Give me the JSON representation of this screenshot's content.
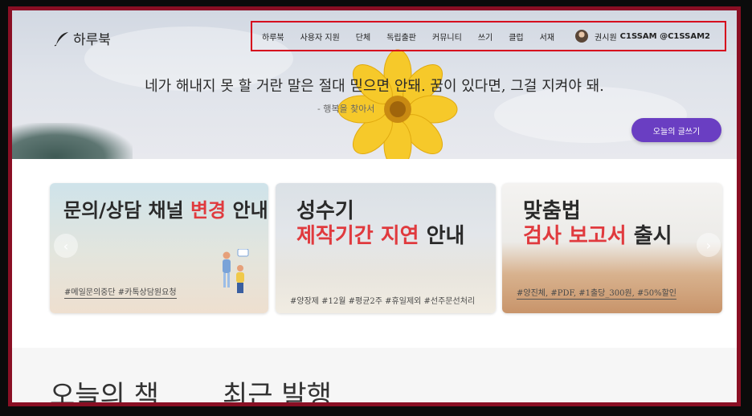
{
  "brand": {
    "logo_text": "하루북"
  },
  "nav": {
    "items": [
      "하루북",
      "사용자 지원",
      "단체",
      "독립출판",
      "커뮤니티",
      "쓰기",
      "클럽",
      "서재"
    ],
    "user_name": "권시원",
    "user_handle": "C1SSAM @C1SSAM2"
  },
  "hero": {
    "quote": "네가 해내지 못 할 거란 말은 절대 믿으면 안돼. 꿈이 있다면, 그걸 지켜야 돼.",
    "quote_source": "- 행복을 찾아서",
    "write_button": "오늘의 글쓰기"
  },
  "cards": [
    {
      "title_before": "문의/상담 채널 ",
      "title_highlight": "변경",
      "title_after": " 안내",
      "tags": "#메일문의중단 #카톡상담원요청"
    },
    {
      "line1": "성수기",
      "line2_highlight": "제작기간 지연",
      "line2_after": " 안내",
      "tags": "#양장제 #12월 #평균2주 #휴일제외 #선주문선처리"
    },
    {
      "line1": "맞춤법",
      "line2_highlight": "검사 보고서",
      "line2_after": " 출시",
      "tags": "#양진체, #PDF, #1출당_300원, #50%할인"
    }
  ],
  "sections": {
    "today_book": "오늘의 책",
    "recent": "최근 발행"
  },
  "icons": {
    "prev": "chevron-left-icon",
    "next": "chevron-right-icon",
    "logo": "quill-icon"
  },
  "colors": {
    "accent": "#6a3ec2",
    "highlight": "#e03a3e",
    "frame": "#8a0f24",
    "nav_box": "#d6001c"
  }
}
